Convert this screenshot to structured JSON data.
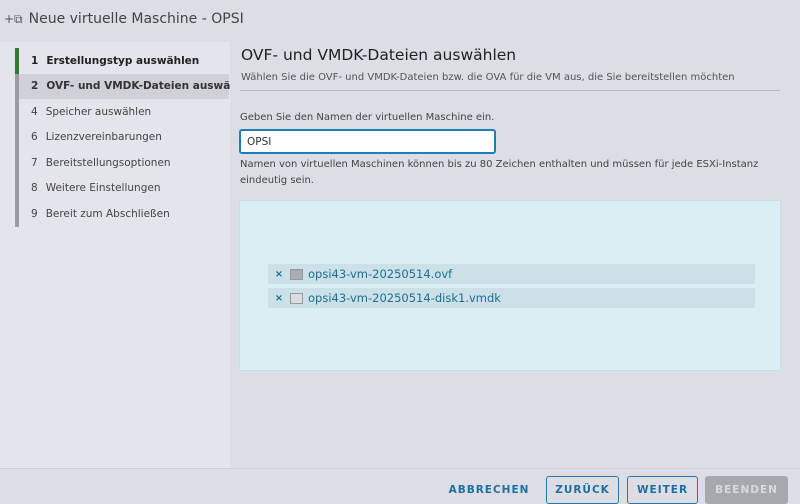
{
  "window": {
    "title": "Neue virtuelle Maschine - OPSI",
    "icon": "add-vm-icon"
  },
  "steps": [
    {
      "num": "1",
      "label": "Erstellungstyp auswählen",
      "state": "done"
    },
    {
      "num": "2",
      "label": "OVF- und VMDK-Dateien auswählen",
      "state": "active"
    },
    {
      "num": "4",
      "label": "Speicher auswählen",
      "state": "pending"
    },
    {
      "num": "6",
      "label": "Lizenzvereinbarungen",
      "state": "pending"
    },
    {
      "num": "7",
      "label": "Bereitstellungsoptionen",
      "state": "pending"
    },
    {
      "num": "8",
      "label": "Weitere Einstellungen",
      "state": "pending"
    },
    {
      "num": "9",
      "label": "Bereit zum Abschließen",
      "state": "pending"
    }
  ],
  "main": {
    "title": "OVF- und VMDK-Dateien auswählen",
    "subtitle": "Wählen Sie die OVF- und VMDK-Dateien bzw. die OVA für die VM aus, die Sie bereitstellen möchten",
    "name_label": "Geben Sie den Namen der virtuellen Maschine ein.",
    "name_value": "OPSI",
    "hint": "Namen von virtuellen Maschinen können bis zu 80 Zeichen enthalten und müssen für jede ESXi-Instanz eindeutig sein.",
    "files": [
      {
        "name": "opsi43-vm-20250514.ovf",
        "icon": "ovf-file-icon"
      },
      {
        "name": "opsi43-vm-20250514-disk1.vmdk",
        "icon": "disk-file-icon"
      }
    ],
    "remove_glyph": "×"
  },
  "footer": {
    "cancel": "ABBRECHEN",
    "back": "ZURÜCK",
    "next": "WEITER",
    "finish": "BEENDEN"
  }
}
